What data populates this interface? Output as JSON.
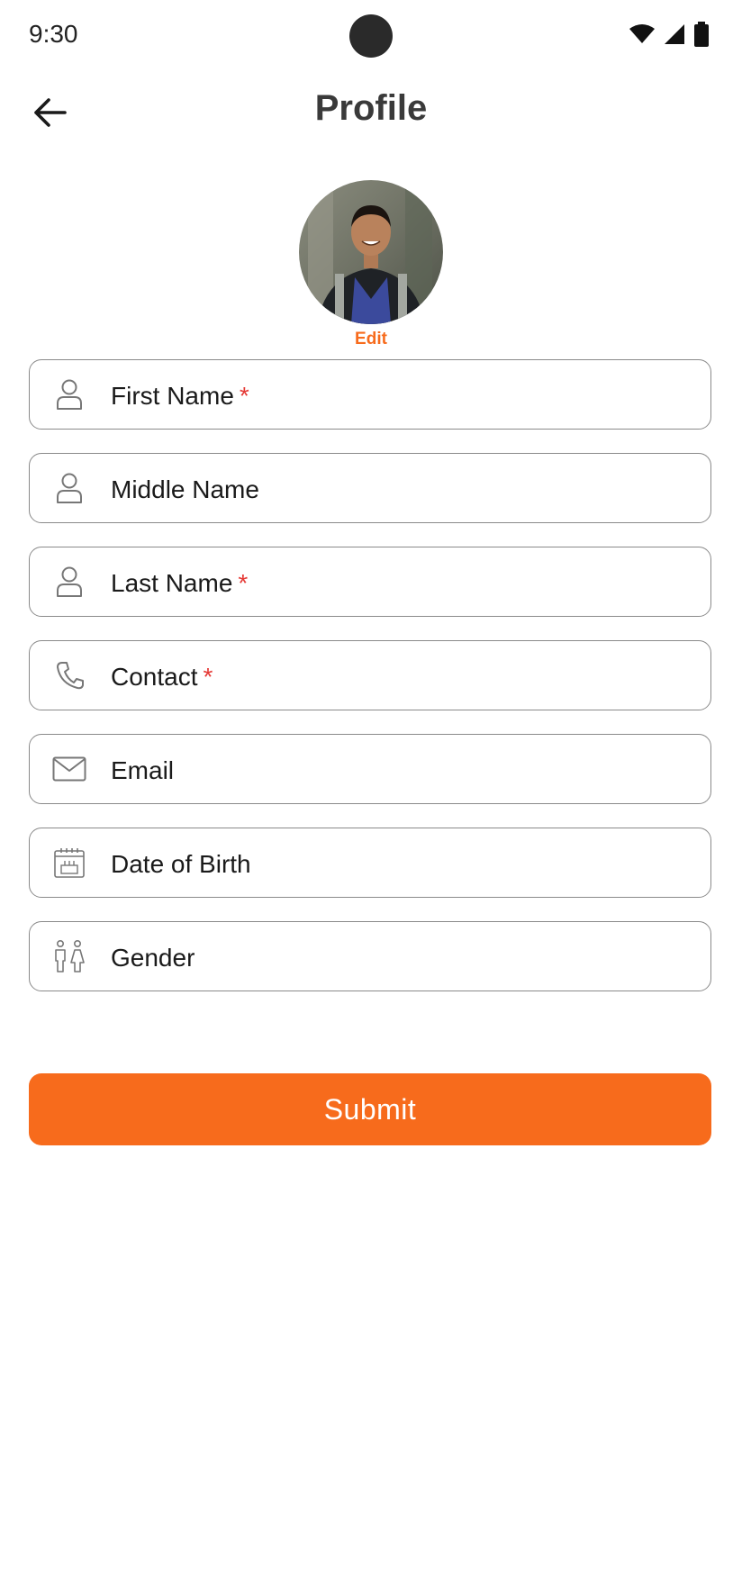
{
  "status_bar": {
    "time": "9:30"
  },
  "header": {
    "title": "Profile"
  },
  "avatar": {
    "edit_label": "Edit"
  },
  "form": {
    "first_name": {
      "label": "First Name",
      "required_mark": "*"
    },
    "middle_name": {
      "label": "Middle Name"
    },
    "last_name": {
      "label": "Last Name",
      "required_mark": "*"
    },
    "contact": {
      "label": "Contact",
      "required_mark": "*"
    },
    "email": {
      "label": "Email"
    },
    "dob": {
      "label": "Date of Birth"
    },
    "gender": {
      "label": "Gender"
    }
  },
  "submit": {
    "label": "Submit"
  },
  "colors": {
    "accent": "#f76b1c",
    "required": "#e53935",
    "border": "#8a8a8a"
  },
  "icons": {
    "back": "arrow-left-icon",
    "user": "user-icon",
    "phone": "phone-icon",
    "email": "envelope-icon",
    "dob": "calendar-cake-icon",
    "gender": "gender-icon"
  }
}
